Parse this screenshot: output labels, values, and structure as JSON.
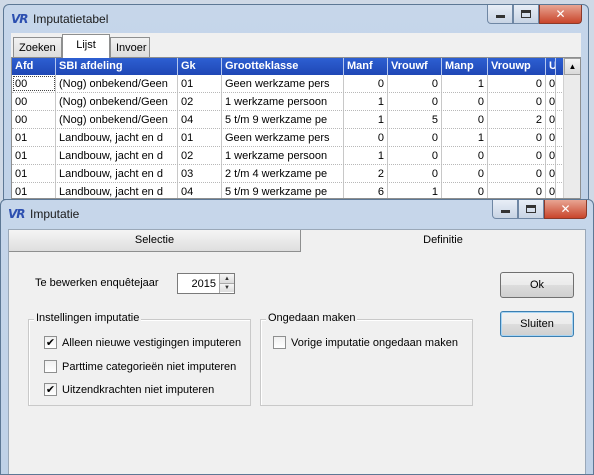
{
  "tabel_window": {
    "title": "Imputatietabel",
    "logo": "VR",
    "tabs": [
      "Zoeken",
      "Lijst",
      "Invoer"
    ],
    "active_tab": "Lijst",
    "columns": [
      "Afd",
      "SBI afdeling",
      "Gk",
      "Grootteklasse",
      "Manf",
      "Vrouwf",
      "Manp",
      "Vrouwp",
      "U"
    ],
    "rows": [
      [
        "00",
        "(Nog) onbekend/Geen",
        "01",
        "Geen werkzame pers",
        "0",
        "0",
        "1",
        "0",
        "0"
      ],
      [
        "00",
        "(Nog) onbekend/Geen",
        "02",
        "1 werkzame persoon",
        "1",
        "0",
        "0",
        "0",
        "0"
      ],
      [
        "00",
        "(Nog) onbekend/Geen",
        "04",
        "5 t/m 9 werkzame pe",
        "1",
        "5",
        "0",
        "2",
        "0"
      ],
      [
        "01",
        "Landbouw, jacht en d",
        "01",
        "Geen werkzame pers",
        "0",
        "0",
        "1",
        "0",
        "0"
      ],
      [
        "01",
        "Landbouw, jacht en d",
        "02",
        "1 werkzame persoon",
        "1",
        "0",
        "0",
        "0",
        "0"
      ],
      [
        "01",
        "Landbouw, jacht en d",
        "03",
        "2 t/m 4 werkzame pe",
        "2",
        "0",
        "0",
        "0",
        "0"
      ],
      [
        "01",
        "Landbouw, jacht en d",
        "04",
        "5 t/m 9 werkzame pe",
        "6",
        "1",
        "0",
        "0",
        "0"
      ]
    ]
  },
  "imp_window": {
    "title": "Imputatie",
    "logo": "VR",
    "tabs": [
      "Selectie",
      "Definitie"
    ],
    "active_tab": "Definitie",
    "year_label": "Te bewerken enquêtejaar",
    "year_value": "2015",
    "group_instellingen": {
      "legend": "Instellingen imputatie",
      "options": [
        {
          "label": "Alleen nieuwe vestigingen imputeren",
          "checked": true
        },
        {
          "label": "Parttime categorieën niet imputeren",
          "checked": false
        },
        {
          "label": "Uitzendkrachten niet imputeren",
          "checked": true
        }
      ]
    },
    "group_ongedaan": {
      "legend": "Ongedaan maken",
      "options": [
        {
          "label": "Vorige imputatie ongedaan maken",
          "checked": false
        }
      ]
    },
    "ok_label": "Ok",
    "close_label": "Sluiten"
  },
  "window_controls": {
    "minimize": "minimize-icon",
    "maximize": "maximize-icon",
    "close": "close-icon"
  }
}
